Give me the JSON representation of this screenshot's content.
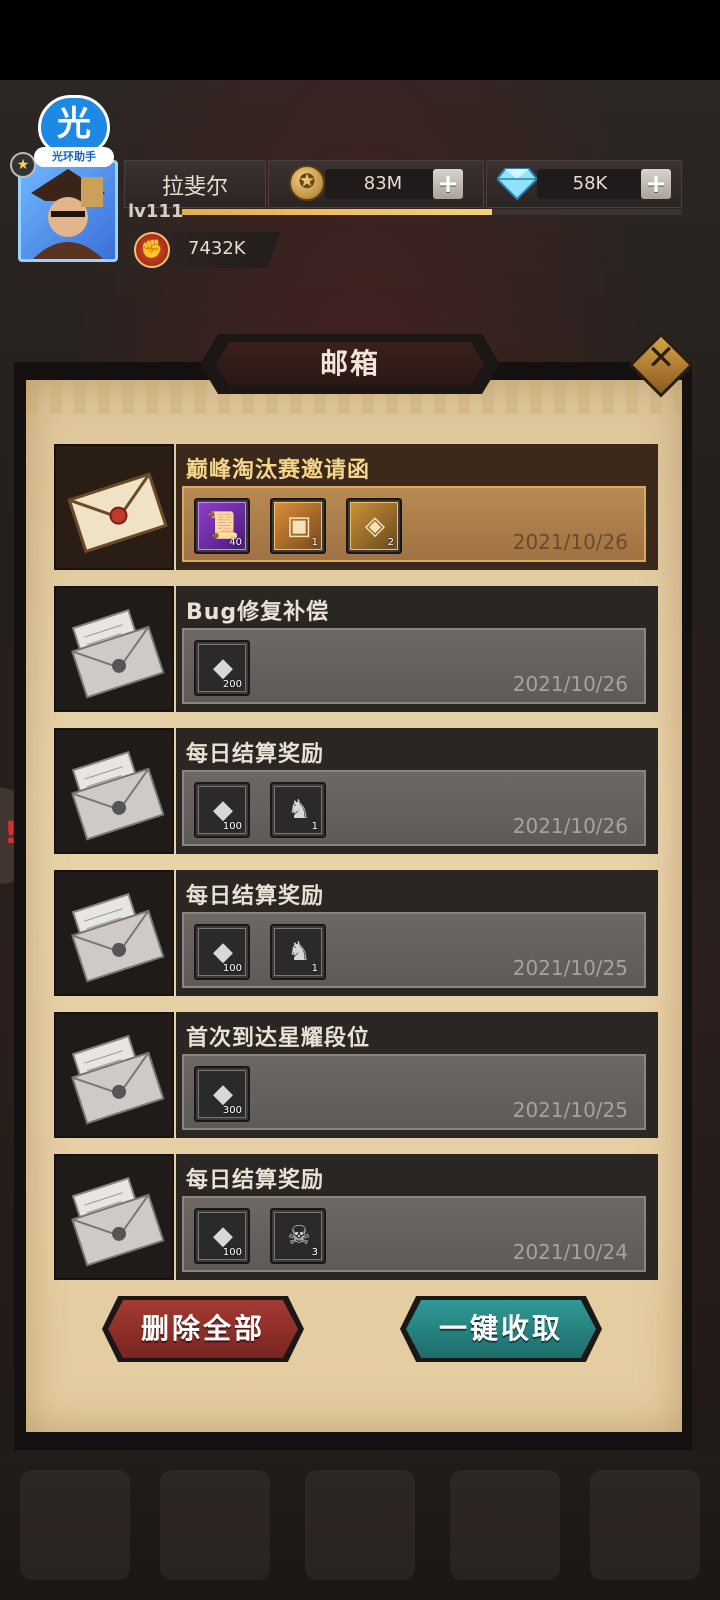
{
  "helper": {
    "logo_char": "光",
    "label": "光环助手"
  },
  "player": {
    "name": "拉斐尔",
    "level": "lv111",
    "xp_fraction": 0.62,
    "power": "7432K"
  },
  "resources": {
    "gold": "83M",
    "diamonds": "58K",
    "plus": "+"
  },
  "mailbox": {
    "title": "邮箱",
    "close_symbol": "✕",
    "mails": [
      {
        "title": "巅峰淘汰赛邀请函",
        "date": "2021/10/26",
        "unread": true,
        "items": [
          {
            "icon": "scroll-icon",
            "count": "40",
            "style": "purple",
            "glyph": "📜"
          },
          {
            "icon": "golden-frame-icon",
            "count": "1",
            "style": "gold",
            "glyph": "▣"
          },
          {
            "icon": "treasure-chest-icon",
            "count": "2",
            "style": "chest",
            "glyph": "◈"
          }
        ]
      },
      {
        "title": "Bug修复补偿",
        "date": "2021/10/26",
        "unread": false,
        "items": [
          {
            "icon": "diamond-icon",
            "count": "200",
            "style": "gray",
            "glyph": "◆"
          }
        ]
      },
      {
        "title": "每日结算奖励",
        "date": "2021/10/26",
        "unread": false,
        "items": [
          {
            "icon": "diamond-icon",
            "count": "100",
            "style": "gray",
            "glyph": "◆"
          },
          {
            "icon": "demon-mask-icon",
            "count": "1",
            "style": "gray",
            "glyph": "♞"
          }
        ]
      },
      {
        "title": "每日结算奖励",
        "date": "2021/10/25",
        "unread": false,
        "items": [
          {
            "icon": "diamond-icon",
            "count": "100",
            "style": "gray",
            "glyph": "◆"
          },
          {
            "icon": "demon-mask-icon",
            "count": "1",
            "style": "gray",
            "glyph": "♞"
          }
        ]
      },
      {
        "title": "首次到达星耀段位",
        "date": "2021/10/25",
        "unread": false,
        "items": [
          {
            "icon": "diamond-icon",
            "count": "300",
            "style": "gray",
            "glyph": "◆"
          }
        ]
      },
      {
        "title": "每日结算奖励",
        "date": "2021/10/24",
        "unread": false,
        "items": [
          {
            "icon": "diamond-icon",
            "count": "100",
            "style": "gray",
            "glyph": "◆"
          },
          {
            "icon": "flame-skull-icon",
            "count": "3",
            "style": "gray",
            "glyph": "☠"
          }
        ]
      }
    ],
    "delete_all_label": "删除全部",
    "claim_all_label": "一键收取"
  },
  "colors": {
    "unread_accent": "#f4d58a",
    "delete_button": "#a33b32",
    "claim_button": "#2f9a96"
  }
}
